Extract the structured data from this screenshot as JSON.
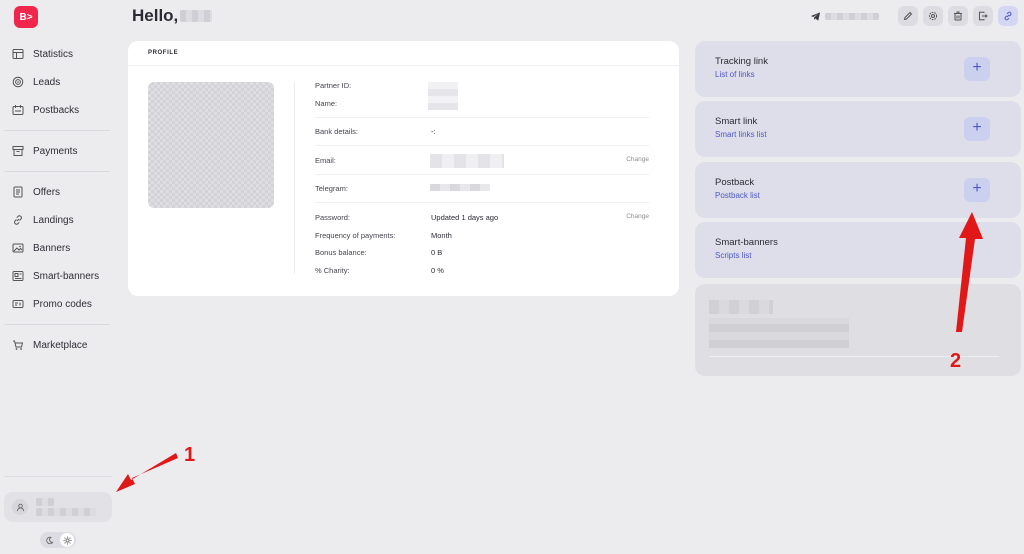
{
  "logo_text": "B>",
  "header": {
    "greeting": "Hello,",
    "icons": [
      "telegram-icon",
      "pencil-icon",
      "gear-icon",
      "trash-icon",
      "logout-icon",
      "link-icon"
    ]
  },
  "sidebar": {
    "items": [
      {
        "label": "Statistics",
        "icon": "table-icon"
      },
      {
        "label": "Leads",
        "icon": "target-icon"
      },
      {
        "label": "Postbacks",
        "icon": "postback-icon"
      },
      {
        "label": "Payments",
        "icon": "archive-icon"
      },
      {
        "label": "Offers",
        "icon": "document-icon"
      },
      {
        "label": "Landings",
        "icon": "link-icon"
      },
      {
        "label": "Banners",
        "icon": "image-icon"
      },
      {
        "label": "Smart-banners",
        "icon": "smart-banner-icon"
      },
      {
        "label": "Promo codes",
        "icon": "promo-icon"
      },
      {
        "label": "Marketplace",
        "icon": "cart-icon"
      }
    ]
  },
  "profile": {
    "section_title": "PROFILE",
    "partner_id_label": "Partner ID:",
    "name_label": "Name:",
    "bank_label": "Bank details:",
    "bank_value": "-:",
    "email_label": "Email:",
    "email_change": "Change",
    "telegram_label": "Telegram:",
    "password_label": "Password:",
    "password_value": "Updated 1 days ago",
    "password_change": "Change",
    "frequency_label": "Frequency of payments:",
    "frequency_value": "Month",
    "bonus_label": "Bonus balance:",
    "bonus_value": "0 B",
    "charity_label": "% Charity:",
    "charity_value": "0 %"
  },
  "panels": [
    {
      "title": "Tracking link",
      "link": "List of links",
      "add": "+"
    },
    {
      "title": "Smart link",
      "link": "Smart links list",
      "add": "+"
    },
    {
      "title": "Postback",
      "link": "Postback list",
      "add": "+"
    },
    {
      "title": "Smart-banners",
      "link": "Scripts list"
    }
  ],
  "annotations": {
    "marker_1": "1",
    "marker_2": "2",
    "color": "#e01818"
  },
  "colors": {
    "brand": "#f0264c",
    "accent": "#5057c8",
    "background": "#ececef"
  }
}
